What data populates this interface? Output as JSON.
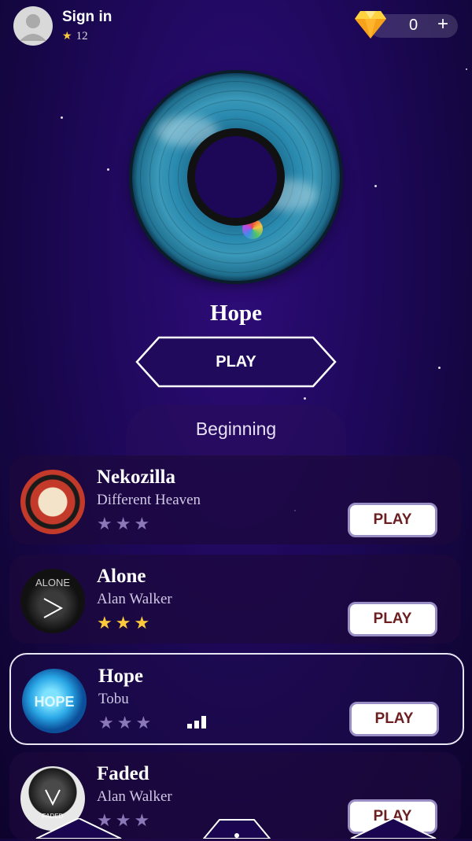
{
  "header": {
    "sign_in_label": "Sign in",
    "star_count": "12",
    "gem_count": "0",
    "gem_plus": "+"
  },
  "featured": {
    "title": "Hope",
    "play_label": "PLAY"
  },
  "level": {
    "label": "Beginning"
  },
  "songs": [
    {
      "title": "Nekozilla",
      "artist": "Different Heaven",
      "stars_earned": 0,
      "play_label": "PLAY"
    },
    {
      "title": "Alone",
      "artist": "Alan Walker",
      "stars_earned": 3,
      "play_label": "PLAY"
    },
    {
      "title": "Hope",
      "artist": "Tobu",
      "stars_earned": 0,
      "play_label": "PLAY",
      "selected": true
    },
    {
      "title": "Faded",
      "artist": "Alan Walker",
      "stars_earned": 0,
      "play_label": "PLAY"
    }
  ],
  "colors": {
    "background": "#1d0858",
    "star_on": "#ffc93c",
    "star_off": "#8a78b8",
    "play_text": "#6b1f20"
  },
  "icons": [
    "avatar-icon",
    "star-icon",
    "gem-icon",
    "plus-icon",
    "bars-icon"
  ]
}
